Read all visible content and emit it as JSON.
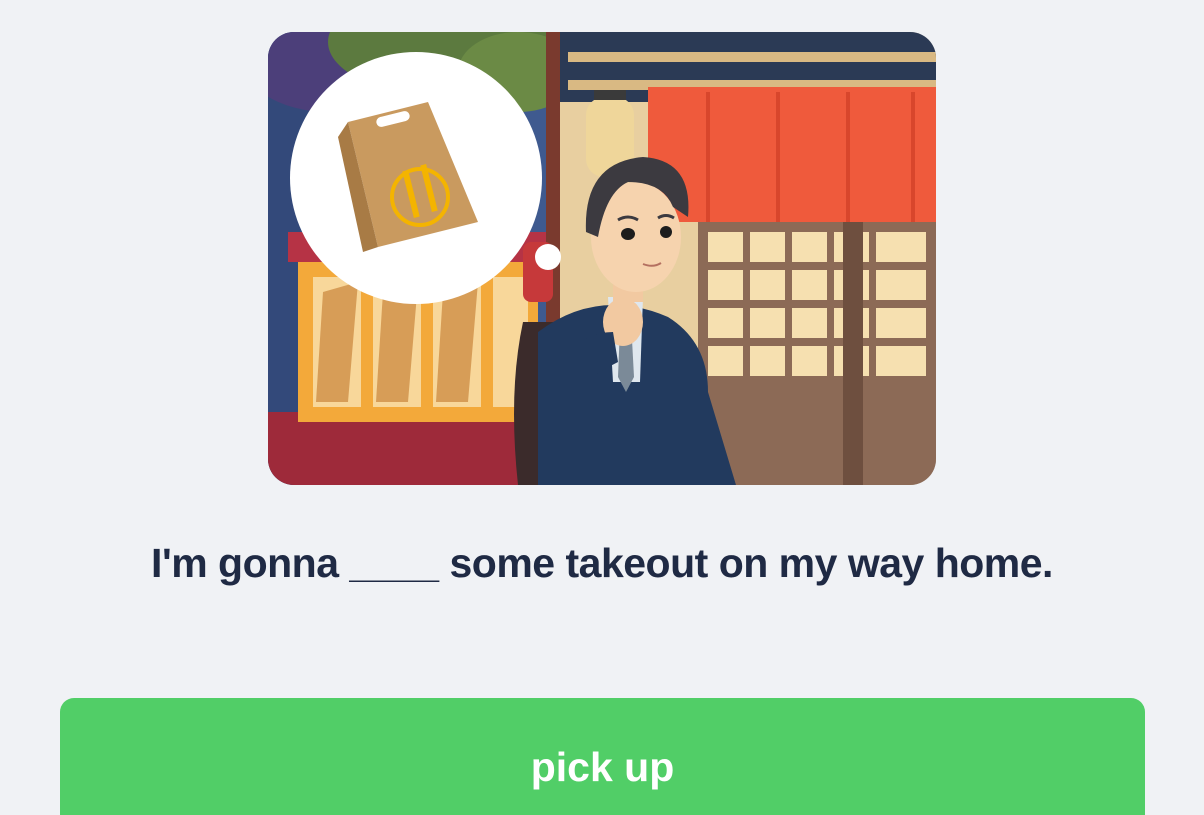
{
  "scene": {
    "illustration": "takeout-scene-illustration",
    "thought_icon": "takeout-bag-icon"
  },
  "question": {
    "sentence": "I'm gonna ____ some takeout on my way home."
  },
  "options": [
    {
      "label": "pick up",
      "color": "#51ce67"
    }
  ],
  "colors": {
    "background": "#f0f2f5",
    "text": "#1f2a44",
    "option": "#51ce67"
  }
}
